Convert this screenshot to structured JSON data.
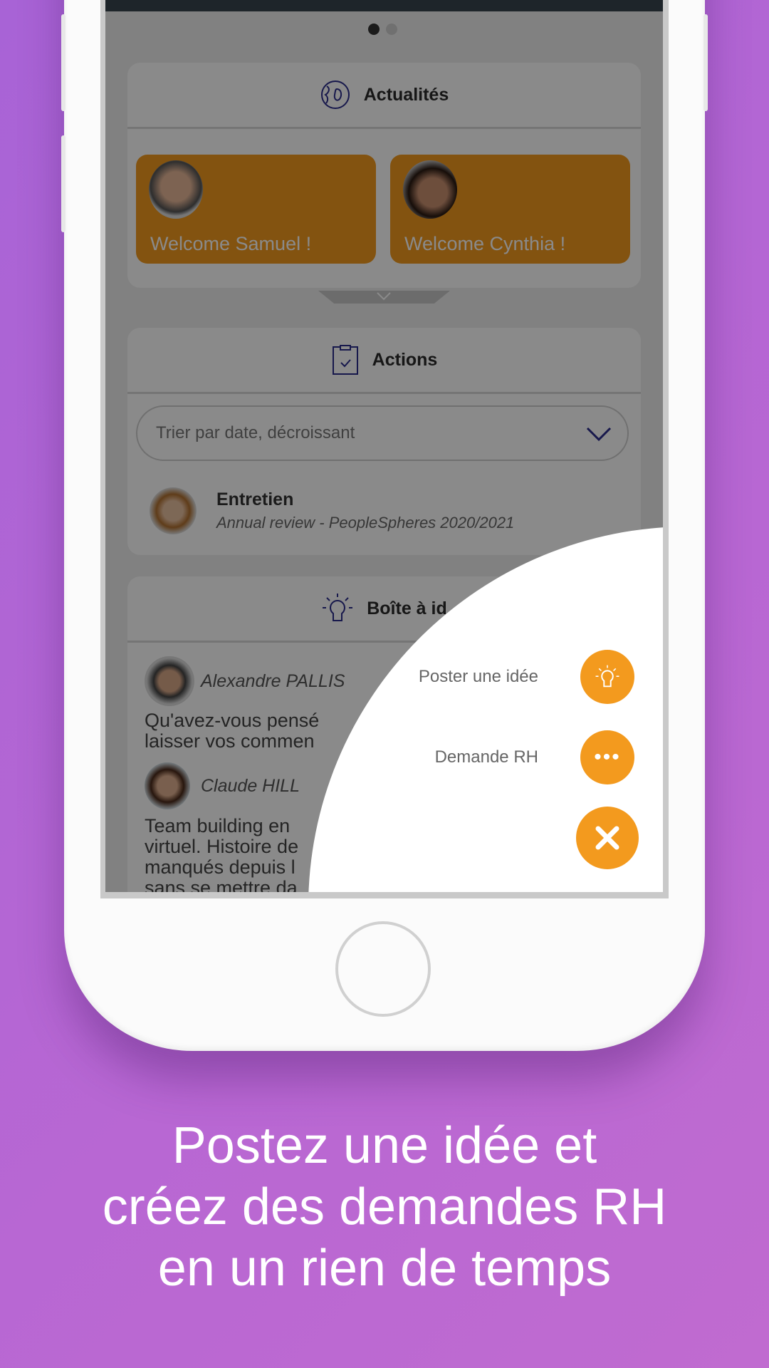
{
  "pager": {
    "active": 0,
    "count": 2
  },
  "news": {
    "title": "Actualités",
    "icon": "globe-icon",
    "items": [
      {
        "label": "Welcome Samuel !"
      },
      {
        "label": "Welcome Cynthia !"
      }
    ]
  },
  "actions": {
    "title": "Actions",
    "icon": "clipboard-check-icon",
    "sort_value": "Trier par date, décroissant",
    "items": [
      {
        "title": "Entretien",
        "subtitle": "Annual review - PeopleSpheres 2020/2021"
      }
    ]
  },
  "ideas": {
    "title": "Boîte à idées",
    "visible_title": "Boîte à id",
    "icon": "lightbulb-icon",
    "posts": [
      {
        "author": "Alexandre PALLIS",
        "lines": [
          "Qu'avez-vous pensé",
          "laisser vos commen"
        ]
      },
      {
        "author": "Claude HILL",
        "lines": [
          "Team building en",
          "virtuel. Histoire de",
          "manqués depuis l",
          "sans se mettre da"
        ]
      }
    ]
  },
  "fab_menu": {
    "items": [
      {
        "label": "Poster une idée",
        "icon": "lightbulb-icon"
      },
      {
        "label": "Demande RH",
        "icon": "more-dots-icon"
      }
    ],
    "close_icon": "close-icon"
  },
  "colors": {
    "accent": "#f39a1e",
    "background": "#b367d4"
  },
  "caption": {
    "lines": [
      "Postez une idée et",
      "créez des demandes RH",
      "en un rien de temps"
    ]
  }
}
